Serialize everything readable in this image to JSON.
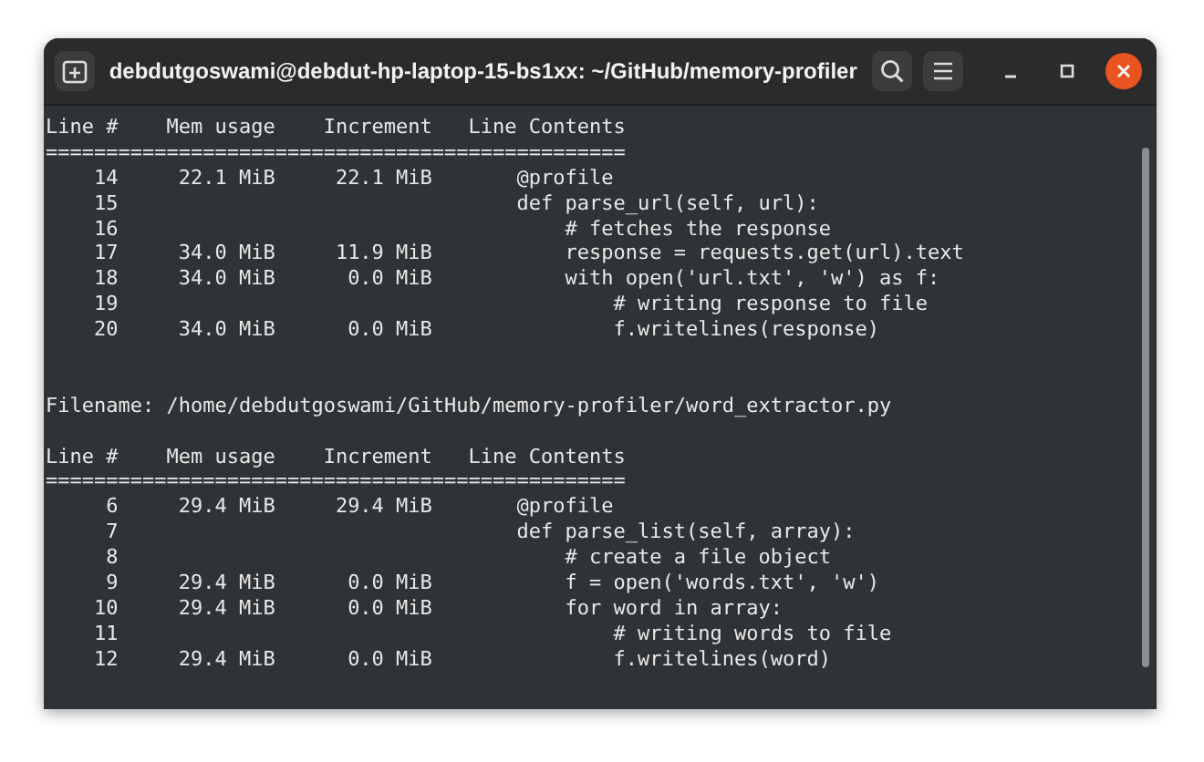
{
  "window": {
    "title": "debdutgoswami@debdut-hp-laptop-15-bs1xx: ~/GitHub/memory-profiler"
  },
  "terminal": {
    "lines": [
      {
        "kind": "text",
        "text": "Line #    Mem usage    Increment   Line Contents"
      },
      {
        "kind": "text",
        "text": "================================================"
      },
      {
        "kind": "text",
        "text": "    14     22.1 MiB     22.1 MiB       @profile"
      },
      {
        "kind": "text",
        "text": "    15                                 def parse_url(self, url):"
      },
      {
        "kind": "text",
        "text": "    16                                     # fetches the response"
      },
      {
        "kind": "text",
        "text": "    17     34.0 MiB     11.9 MiB           response = requests.get(url).text"
      },
      {
        "kind": "text",
        "text": "    18     34.0 MiB      0.0 MiB           with open('url.txt', 'w') as f:"
      },
      {
        "kind": "text",
        "text": "    19                                         # writing response to file"
      },
      {
        "kind": "text",
        "text": "    20     34.0 MiB      0.0 MiB               f.writelines(response)"
      },
      {
        "kind": "blank"
      },
      {
        "kind": "blank"
      },
      {
        "kind": "text",
        "text": "Filename: /home/debdutgoswami/GitHub/memory-profiler/word_extractor.py"
      },
      {
        "kind": "blank"
      },
      {
        "kind": "text",
        "text": "Line #    Mem usage    Increment   Line Contents"
      },
      {
        "kind": "text",
        "text": "================================================"
      },
      {
        "kind": "text",
        "text": "     6     29.4 MiB     29.4 MiB       @profile"
      },
      {
        "kind": "text",
        "text": "     7                                 def parse_list(self, array):"
      },
      {
        "kind": "text",
        "text": "     8                                     # create a file object"
      },
      {
        "kind": "text",
        "text": "     9     29.4 MiB      0.0 MiB           f = open('words.txt', 'w')"
      },
      {
        "kind": "text",
        "text": "    10     29.4 MiB      0.0 MiB           for word in array:"
      },
      {
        "kind": "text",
        "text": "    11                                         # writing words to file"
      },
      {
        "kind": "text",
        "text": "    12     29.4 MiB      0.0 MiB               f.writelines(word)"
      }
    ]
  }
}
